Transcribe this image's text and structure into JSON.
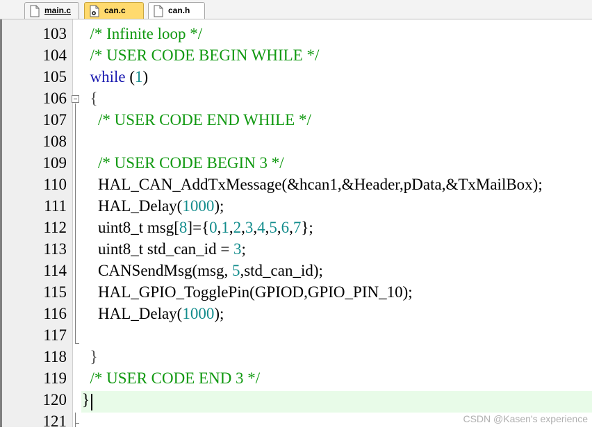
{
  "tabs": [
    {
      "label": "main.c",
      "icon": "c-file-icon"
    },
    {
      "label": "can.c",
      "icon": "c-file-modified-icon"
    },
    {
      "label": "can.h",
      "icon": "h-file-icon"
    }
  ],
  "lines": [
    {
      "n": "103",
      "parts": [
        [
          "cm",
          "  /* Infinite loop */"
        ]
      ]
    },
    {
      "n": "104",
      "parts": [
        [
          "cm",
          "  /* USER CODE BEGIN WHILE */"
        ]
      ]
    },
    {
      "n": "105",
      "parts": [
        [
          "kw",
          "  while"
        ],
        [
          "",
          " ("
        ],
        [
          "num",
          "1"
        ],
        [
          "",
          ")"
        ]
      ]
    },
    {
      "n": "106",
      "parts": [
        [
          "brace",
          "  {"
        ]
      ]
    },
    {
      "n": "107",
      "parts": [
        [
          "cm",
          "    /* USER CODE END WHILE */"
        ]
      ]
    },
    {
      "n": "108",
      "parts": []
    },
    {
      "n": "109",
      "parts": [
        [
          "cm",
          "    /* USER CODE BEGIN 3 */"
        ]
      ]
    },
    {
      "n": "110",
      "parts": [
        [
          "",
          "    HAL_CAN_AddTxMessage(&hcan1,&Header,pData,&TxMailBox);"
        ]
      ]
    },
    {
      "n": "111",
      "parts": [
        [
          "",
          "    HAL_Delay("
        ],
        [
          "num",
          "1000"
        ],
        [
          "",
          ");"
        ]
      ]
    },
    {
      "n": "112",
      "parts": [
        [
          "",
          "    uint8_t msg["
        ],
        [
          "num",
          "8"
        ],
        [
          "",
          "]={"
        ],
        [
          "num",
          "0"
        ],
        [
          "",
          ","
        ],
        [
          "num",
          "1"
        ],
        [
          "",
          ","
        ],
        [
          "num",
          "2"
        ],
        [
          "",
          ","
        ],
        [
          "num",
          "3"
        ],
        [
          "",
          ","
        ],
        [
          "num",
          "4"
        ],
        [
          "",
          ","
        ],
        [
          "num",
          "5"
        ],
        [
          "",
          ","
        ],
        [
          "num",
          "6"
        ],
        [
          "",
          ","
        ],
        [
          "num",
          "7"
        ],
        [
          "",
          "};"
        ]
      ]
    },
    {
      "n": "113",
      "parts": [
        [
          "",
          "    uint8_t std_can_id = "
        ],
        [
          "num",
          "3"
        ],
        [
          "",
          ";"
        ]
      ]
    },
    {
      "n": "114",
      "parts": [
        [
          "",
          "    CANSendMsg(msg, "
        ],
        [
          "num",
          "5"
        ],
        [
          "",
          ",std_can_id);"
        ]
      ]
    },
    {
      "n": "115",
      "parts": [
        [
          "",
          "    HAL_GPIO_TogglePin(GPIOD,GPIO_PIN_10);"
        ]
      ]
    },
    {
      "n": "116",
      "parts": [
        [
          "",
          "    HAL_Delay("
        ],
        [
          "num",
          "1000"
        ],
        [
          "",
          ");"
        ]
      ]
    },
    {
      "n": "117",
      "parts": []
    },
    {
      "n": "118",
      "parts": [
        [
          "brace",
          "  }"
        ]
      ]
    },
    {
      "n": "119",
      "parts": [
        [
          "cm",
          "  /* USER CODE END 3 */"
        ]
      ]
    },
    {
      "n": "120",
      "parts": [
        [
          "",
          "}"
        ]
      ]
    },
    {
      "n": "121",
      "parts": []
    }
  ],
  "colors": {
    "comment": "#119911",
    "keyword": "#1a1ab0",
    "number": "#128c8c",
    "current_line": "#e8fbe8",
    "active_tab": "#ffda6e"
  },
  "watermark": "CSDN @Kasen's experience"
}
